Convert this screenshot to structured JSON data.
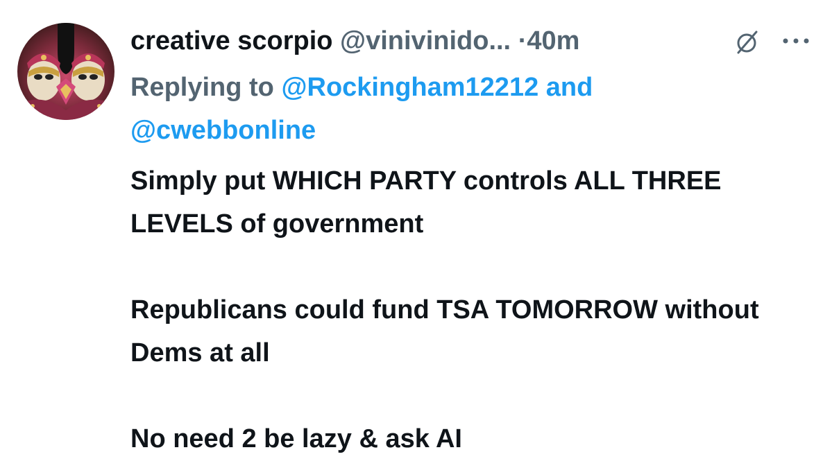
{
  "author": {
    "display_name": "creative scorpio",
    "handle": "@vinivinido...",
    "separator": "·",
    "time": "40m"
  },
  "reply_context": {
    "prefix": "Replying to",
    "mention_1": "@Rockingham12212",
    "conjunction": "and",
    "mention_2": "@cwebbonline"
  },
  "body": {
    "paragraph_1": "Simply put WHICH PARTY controls ALL THREE LEVELS of government",
    "paragraph_2": "Republicans could fund TSA TOMORROW without Dems at all",
    "paragraph_3": "No need 2 be lazy & ask AI"
  },
  "icons": {
    "avatar": "masquerade-masks-avatar",
    "grok": "grok-icon",
    "more": "more-options-icon"
  },
  "colors": {
    "text": "#0f1419",
    "secondary": "#536471",
    "link": "#1d9bf0"
  }
}
